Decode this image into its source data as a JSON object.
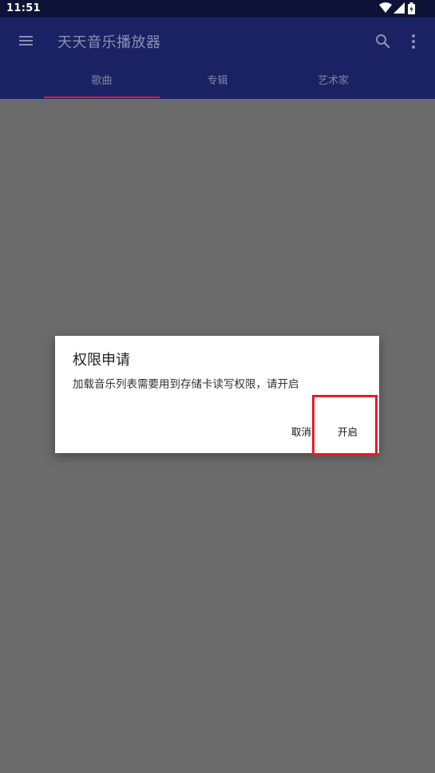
{
  "status_bar": {
    "time": "11:51"
  },
  "app_bar": {
    "title": "天天音乐播放器"
  },
  "tabs": [
    {
      "label": "歌曲",
      "selected": true
    },
    {
      "label": "专辑",
      "selected": false
    },
    {
      "label": "艺术家",
      "selected": false
    }
  ],
  "dialog": {
    "title": "权限申请",
    "message": "加载音乐列表需要用到存储卡读写权限，请开启",
    "cancel_label": "取消",
    "confirm_label": "开启"
  },
  "colors": {
    "status_bar": "#0d1336",
    "app_bar": "#1b2264",
    "tab_indicator": "#e5143c",
    "scrim": "#6b6b6b",
    "highlight": "#e51c2a"
  }
}
